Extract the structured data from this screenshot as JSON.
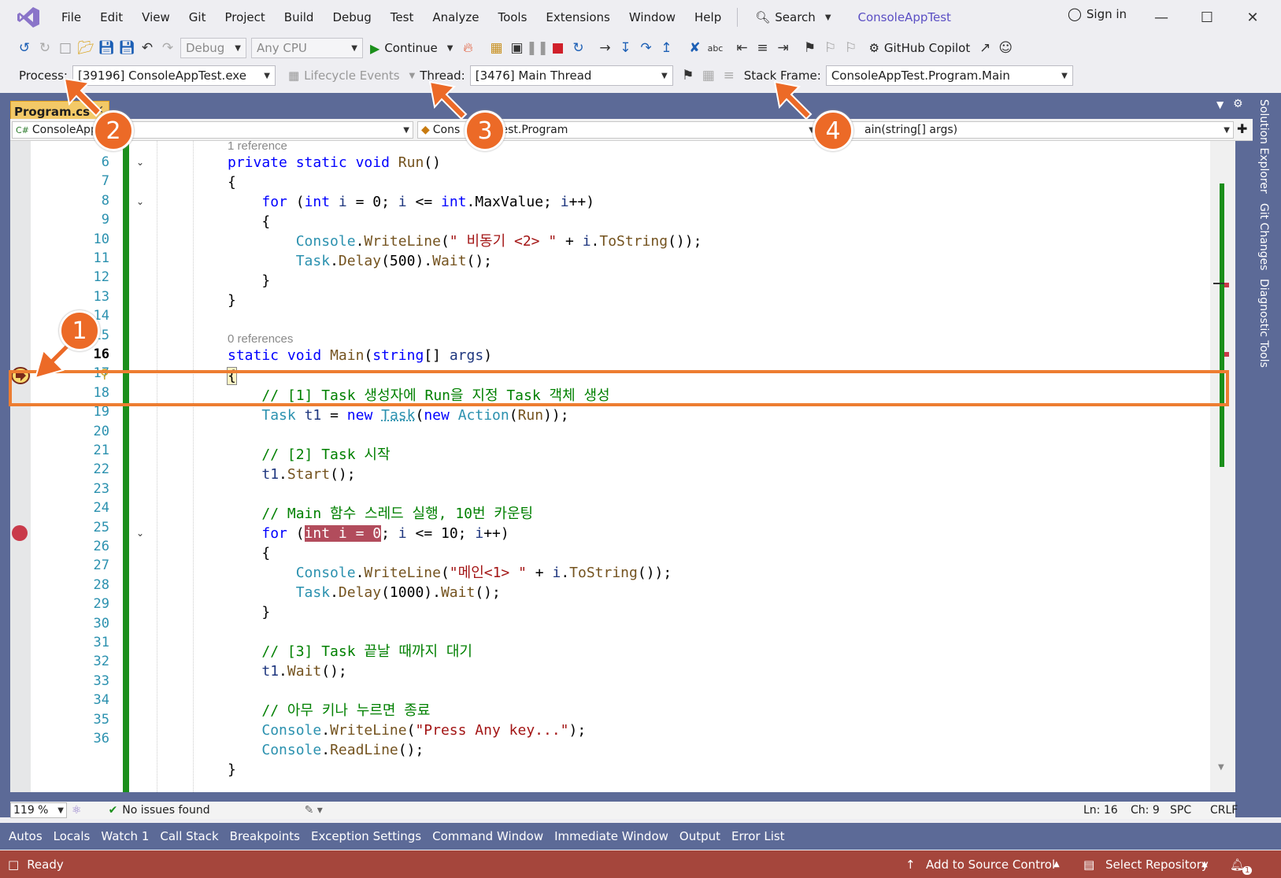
{
  "menu": {
    "items": [
      "File",
      "Edit",
      "View",
      "Git",
      "Project",
      "Build",
      "Debug",
      "Test",
      "Analyze",
      "Tools",
      "Extensions",
      "Window",
      "Help"
    ],
    "search": "Search",
    "solution": "ConsoleAppTest",
    "signin": "Sign in"
  },
  "toolbar1": {
    "config": "Debug",
    "platform": "Any CPU",
    "continue": "Continue",
    "copilot": "GitHub Copilot"
  },
  "toolbar2": {
    "process_label": "Process:",
    "process_value": "[39196] ConsoleAppTest.exe",
    "lifecycle": "Lifecycle Events",
    "thread_label": "Thread:",
    "thread_value": "[3476] Main Thread",
    "stackframe_label": "Stack Frame:",
    "stackframe_value": "ConsoleAppTest.Program.Main"
  },
  "tab": {
    "name": "Program.cs"
  },
  "nav": {
    "project": "ConsoleApp",
    "class": "Cons",
    "class_suffix": "Test.Program",
    "member": "ain(string[] args)"
  },
  "code": {
    "ref1": "1 reference",
    "ref0": "0 references",
    "lines": [
      "6",
      "7",
      "8",
      "9",
      "10",
      "11",
      "12",
      "13",
      "14",
      "15",
      "16",
      "17",
      "18",
      "19",
      "20",
      "21",
      "22",
      "23",
      "24",
      "25",
      "26",
      "27",
      "28",
      "29",
      "30",
      "31",
      "32",
      "33",
      "34",
      "35",
      "36"
    ]
  },
  "editor_status": {
    "zoom": "119 %",
    "issues": "No issues found",
    "ln": "Ln: 16",
    "ch": "Ch: 9",
    "spc": "SPC",
    "crlf": "CRLF"
  },
  "side_tabs": [
    "Solution Explorer",
    "Git Changes",
    "Diagnostic Tools"
  ],
  "bottom_tabs": [
    "Autos",
    "Locals",
    "Watch 1",
    "Call Stack",
    "Breakpoints",
    "Exception Settings",
    "Command Window",
    "Immediate Window",
    "Output",
    "Error List"
  ],
  "statusbar": {
    "ready": "Ready",
    "source_control": "Add to Source Control",
    "repo": "Select Repository",
    "notifications": "1"
  },
  "callouts": [
    "1",
    "2",
    "3",
    "4"
  ],
  "colors": {
    "accent": "#ec6a27",
    "statusbar": "#a5463c",
    "docwell": "#5c6a97",
    "tab_active": "#f3c967"
  }
}
